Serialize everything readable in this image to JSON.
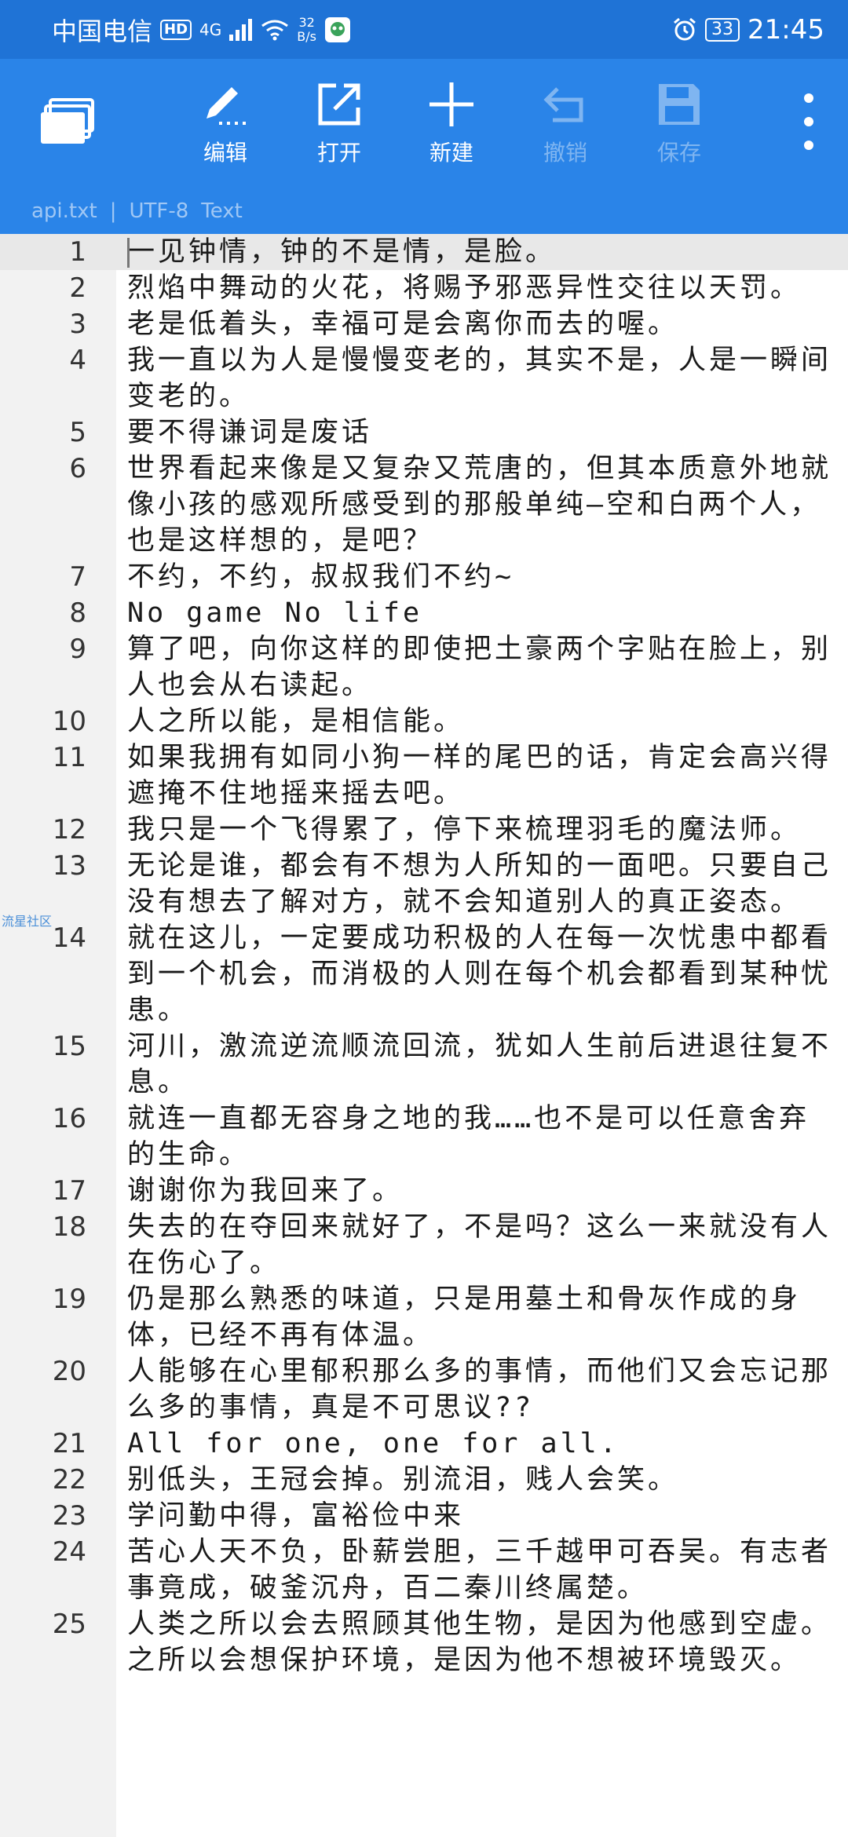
{
  "status_bar": {
    "carrier": "中国电信",
    "hd": "HD",
    "signal_tag": "4G",
    "net_speed_value": "32",
    "net_speed_unit": "B/s",
    "battery": "33",
    "time": "21:45"
  },
  "toolbar": {
    "edit": "编辑",
    "open": "打开",
    "new": "新建",
    "undo": "撤销",
    "save": "保存"
  },
  "file_info": {
    "filename": "api.txt",
    "separator": "|",
    "encoding": "UTF-8",
    "mode": "Text"
  },
  "watermark": "流星社区",
  "lines": [
    {
      "n": "1",
      "text": "一见钟情，钟的不是情，是脸。"
    },
    {
      "n": "2",
      "text": "烈焰中舞动的火花，将赐予邪恶异性交往以天罚。"
    },
    {
      "n": "3",
      "text": "老是低着头，幸福可是会离你而去的喔。"
    },
    {
      "n": "4",
      "text": "我一直以为人是慢慢变老的，其实不是，人是一瞬间变老的。"
    },
    {
      "n": "5",
      "text": "要不得谦词是废话"
    },
    {
      "n": "6",
      "text": "世界看起来像是又复杂又荒唐的，但其本质意外地就像小孩的感观所感受到的那般单纯—空和白两个人，也是这样想的，是吧？"
    },
    {
      "n": "7",
      "text": "不约，不约，叔叔我们不约~"
    },
    {
      "n": "8",
      "text": "No game No life"
    },
    {
      "n": "9",
      "text": "算了吧，向你这样的即使把土豪两个字贴在脸上，别人也会从右读起。"
    },
    {
      "n": "10",
      "text": "人之所以能，是相信能。"
    },
    {
      "n": "11",
      "text": "如果我拥有如同小狗一样的尾巴的话，肯定会高兴得遮掩不住地摇来摇去吧。"
    },
    {
      "n": "12",
      "text": "我只是一个飞得累了，停下来梳理羽毛的魔法师。"
    },
    {
      "n": "13",
      "text": "无论是谁，都会有不想为人所知的一面吧。只要自己没有想去了解对方，就不会知道别人的真正姿态。"
    },
    {
      "n": "14",
      "text": "就在这儿，一定要成功积极的人在每一次忧患中都看到一个机会，而消极的人则在每个机会都看到某种忧患。"
    },
    {
      "n": "15",
      "text": "河川，激流逆流顺流回流，犹如人生前后进退往复不息。"
    },
    {
      "n": "16",
      "text": "就连一直都无容身之地的我……也不是可以任意舍弃的生命。"
    },
    {
      "n": "17",
      "text": "谢谢你为我回来了。"
    },
    {
      "n": "18",
      "text": "失去的在夺回来就好了，不是吗？这么一来就没有人在伤心了。"
    },
    {
      "n": "19",
      "text": "仍是那么熟悉的味道，只是用墓土和骨灰作成的身体，已经不再有体温。"
    },
    {
      "n": "20",
      "text": "人能够在心里郁积那么多的事情，而他们又会忘记那么多的事情，真是不可思议??"
    },
    {
      "n": "21",
      "text": "All for one, one for all."
    },
    {
      "n": "22",
      "text": "别低头，王冠会掉。别流泪，贱人会笑。"
    },
    {
      "n": "23",
      "text": "学问勤中得，富裕俭中来"
    },
    {
      "n": "24",
      "text": "苦心人天不负，卧薪尝胆，三千越甲可吞吴。有志者事竟成，破釜沉舟，百二秦川终属楚。"
    },
    {
      "n": "25",
      "text": "人类之所以会去照顾其他生物，是因为他感到空虚。之所以会想保护环境，是因为他不想被环境毁灭。"
    }
  ]
}
